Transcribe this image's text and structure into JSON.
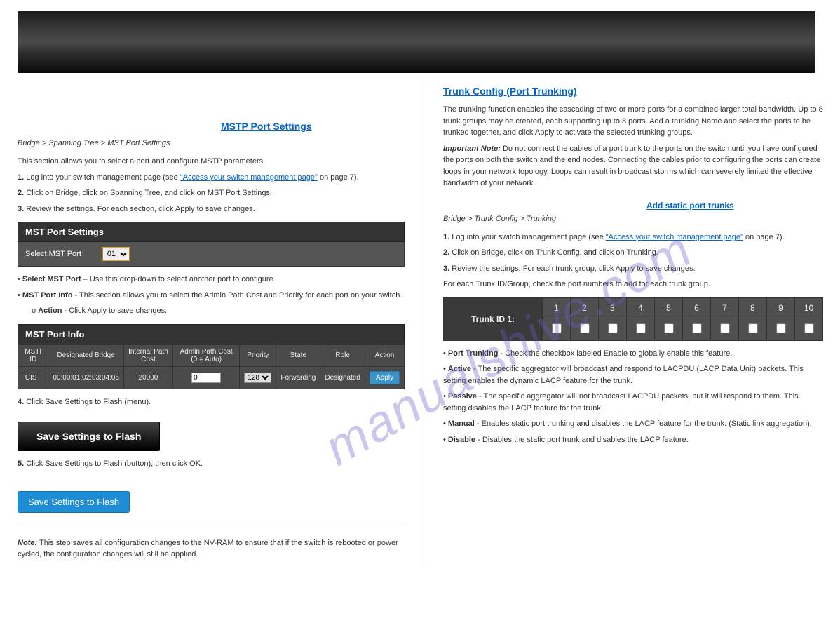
{
  "watermark": "manualshive.com",
  "left": {
    "title": "MSTP Port Settings",
    "nav": "Bridge > Spanning Tree > MST Port Settings",
    "p1": "This section allows you to select a port and configure MSTP parameters.",
    "step1_num": "1.",
    "step1": "Log into your switch management page (see ",
    "step1_link": "\"Access your switch management page\"",
    "step1_end": " on page 7).",
    "step2_num": "2.",
    "step2": "Click on Bridge, click on Spanning Tree, and click on MST Port Settings.",
    "step3_num": "3.",
    "step3": "Review the settings. For each section, click Apply to save changes.",
    "mst_settings_title": "MST Port Settings",
    "select_label": "Select MST Port",
    "select_value": "01",
    "bullet1_title": "Select MST Port",
    "bullet1_text": " – Use this drop-down to select another port to configure.",
    "bullet2_title": "MST Port Info",
    "bullet2_text": " - This section allows you to select the Admin Path Cost and Priority for each port on your switch.",
    "bullet3_title": "Action",
    "bullet3_text": " - Click Apply to save changes.",
    "info_title": "MST Port Info",
    "headers": [
      "MSTI ID",
      "Designated Bridge",
      "Internal Path Cost",
      "Admin Path Cost (0 = Auto)",
      "Priority",
      "State",
      "Role",
      "Action"
    ],
    "row": {
      "msti": "CIST",
      "bridge": "00:00:01:02:03:04:05",
      "int_path": "20000",
      "admin_path": "0",
      "priority": "128",
      "state": "Forwarding",
      "role": "Designated",
      "action": "Apply"
    },
    "save_dark": "Save Settings to Flash",
    "step4_num": "4.",
    "step4": "Click Save Settings to Flash (menu).",
    "step5_num": "5.",
    "step5": "Click Save Settings to Flash (button), then click OK.",
    "save_blue": "Save Settings to Flash",
    "note_label": "Note:",
    "note_text": " This step saves all configuration changes to the NV-RAM to ensure that if the switch is rebooted or power cycled, the configuration changes will still be applied."
  },
  "right": {
    "trunk_title": "Trunk Config (Port Trunking)",
    "intro": "The trunking function enables the cascading of two or more ports for a combined larger total bandwidth. Up to 8 trunk groups may be created, each supporting up to 8 ports. Add a trunking Name and select the ports to be trunked together, and click Apply to activate the selected trunking groups.",
    "note1_a": "Important Note:",
    "note1_b": " Do not connect the cables of a port trunk to the ports on the switch until you have configured the ports on both the switch and the end nodes. Connecting the cables prior to configuring the ports can create loops in your network topology. Loops can result in broadcast storms which can severely limited the effective bandwidth of your network.",
    "sub1": "Add static port trunks",
    "nav": "Bridge > Trunk Config > Trunking",
    "step1_num": "1.",
    "step1": "Log into your switch management page (see ",
    "step1_link": "\"Access your switch management page\"",
    "step1_end": " on page 7).",
    "step2_num": "2.",
    "step2": "Click on Bridge, click on Trunk Config, and click on Trunking.",
    "step3_num": "3.",
    "step3": "Review the settings. For each trunk group, click Apply to save changes.",
    "p2": "For each Trunk ID/Group, check the port numbers to add for each trunk group.",
    "trunk_row_head": "Trunk ID 1:",
    "ports": [
      "1",
      "2",
      "3",
      "4",
      "5",
      "6",
      "7",
      "8",
      "9",
      "10"
    ],
    "b1_t": "Port Trunking",
    "b1_x": " - Check the checkbox labeled Enable to globally enable this feature.",
    "b2_t": "Active",
    "b2_x": " - The specific aggregator will broadcast and respond to LACPDU (LACP Data Unit) packets. This setting enables the dynamic LACP feature for the trunk.",
    "b3_t": "Passive",
    "b3_x": " - The specific aggregator will not broadcast LACPDU packets, but it will respond to them. This setting disables the LACP feature for the trunk",
    "b4_t": "Manual",
    "b4_x": " - Enables static port trunking and disables the LACP feature for the trunk. (Static link aggregation).",
    "b5_t": "Disable",
    "b5_x": " - Disables the static port trunk and disables the LACP feature."
  }
}
